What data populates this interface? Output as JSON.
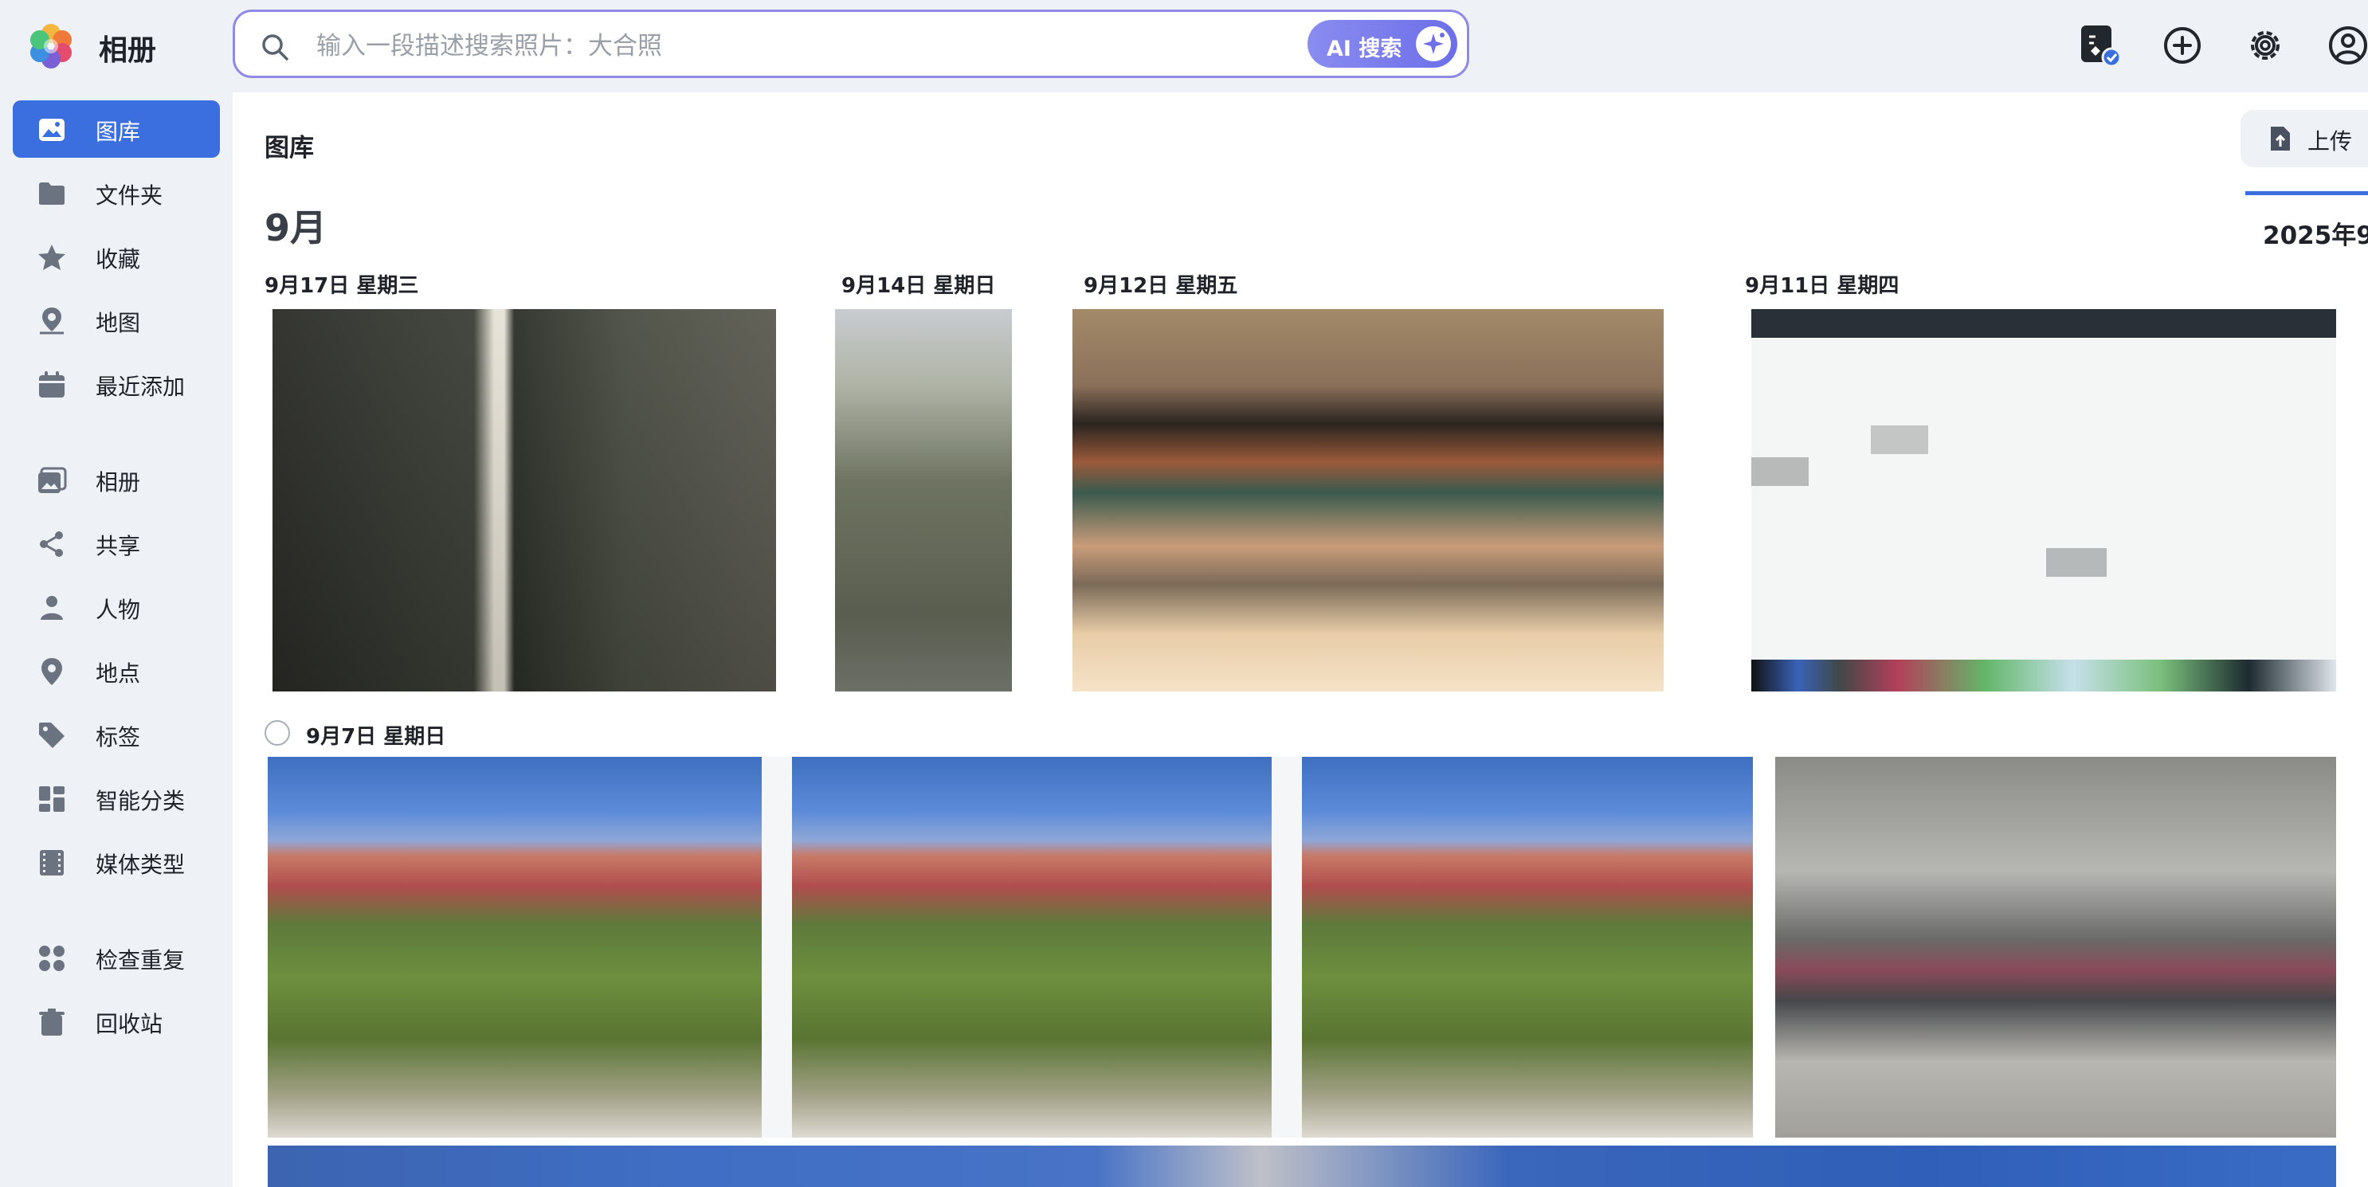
{
  "app": {
    "title": "相册"
  },
  "search": {
    "placeholder": "输入一段描述搜索照片：大合照",
    "ai_label": "AI 搜索"
  },
  "topbar_icons": [
    "document-check-icon",
    "add-circle-icon",
    "gear-icon",
    "account-icon"
  ],
  "sidebar": {
    "items": [
      {
        "label": "图库",
        "icon": "photo-library-icon",
        "active": true
      },
      {
        "label": "文件夹",
        "icon": "folder-icon"
      },
      {
        "label": "收藏",
        "icon": "star-icon"
      },
      {
        "label": "地图",
        "icon": "map-pin-icon"
      },
      {
        "label": "最近添加",
        "icon": "calendar-icon"
      },
      {
        "label": "相册",
        "icon": "album-icon"
      },
      {
        "label": "共享",
        "icon": "share-icon"
      },
      {
        "label": "人物",
        "icon": "person-icon"
      },
      {
        "label": "地点",
        "icon": "location-icon"
      },
      {
        "label": "标签",
        "icon": "tag-icon"
      },
      {
        "label": "智能分类",
        "icon": "grid-icon"
      },
      {
        "label": "媒体类型",
        "icon": "film-icon"
      },
      {
        "label": "检查重复",
        "icon": "duplicate-icon"
      },
      {
        "label": "回收站",
        "icon": "trash-icon"
      }
    ]
  },
  "main": {
    "breadcrumb": "图库",
    "upload_label": "上传",
    "timeline_label": "2025年9",
    "month": "9月",
    "dates": [
      "9月17日 星期三",
      "9月14日 星期日",
      "9月12日 星期五",
      "9月11日 星期四",
      "9月7日 星期日"
    ]
  },
  "colors": {
    "accent": "#3b6fe0",
    "ai_gradient_start": "#8a8cf0",
    "ai_gradient_end": "#6c6fe8"
  }
}
